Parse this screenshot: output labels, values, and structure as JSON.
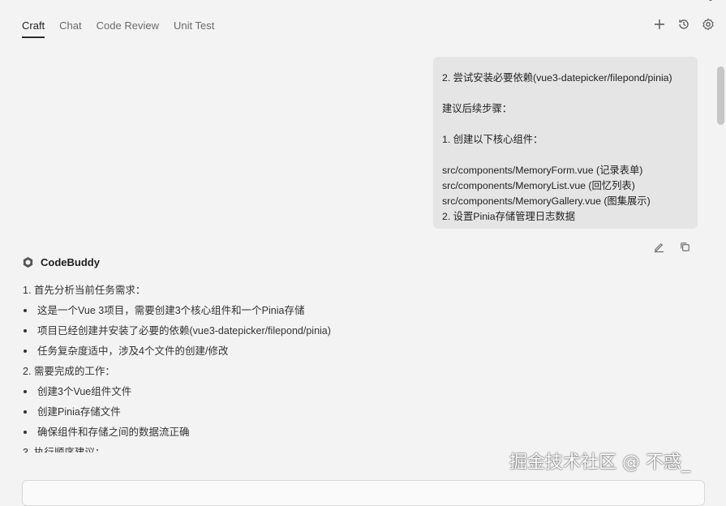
{
  "tabs": [
    {
      "label": "Craft",
      "active": true
    },
    {
      "label": "Chat",
      "active": false
    },
    {
      "label": "Code Review",
      "active": false
    },
    {
      "label": "Unit Test",
      "active": false
    }
  ],
  "header_icons": [
    "plus-icon",
    "history-icon",
    "settings-icon"
  ],
  "user_message": {
    "lines": [
      "2. 尝试安装必要依赖(vue3-datepicker/filepond/pinia)",
      "",
      "建议后续步骤：",
      "",
      "1. 创建以下核心组件：",
      "",
      "src/components/MemoryForm.vue (记录表单)",
      "src/components/MemoryList.vue (回忆列表)",
      "src/components/MemoryGallery.vue (图集展示)",
      "2. 设置Pinia存储管理日志数据"
    ]
  },
  "message_actions": [
    "edit-icon",
    "copy-icon"
  ],
  "assistant": {
    "name": "CodeBuddy",
    "lines": [
      {
        "text": "1. 首先分析当前任务需求：",
        "bullet": false
      },
      {
        "text": "这是一个Vue 3项目，需要创建3个核心组件和一个Pinia存储",
        "bullet": true
      },
      {
        "text": "项目已经创建并安装了必要的依赖(vue3-datepicker/filepond/pinia)",
        "bullet": true
      },
      {
        "text": "任务复杂度适中，涉及4个文件的创建/修改",
        "bullet": true
      },
      {
        "text": "2. 需要完成的工作：",
        "bullet": false
      },
      {
        "text": "创建3个Vue组件文件",
        "bullet": true
      },
      {
        "text": "创建Pinia存储文件",
        "bullet": true
      },
      {
        "text": "确保组件和存储之间的数据流正确",
        "bullet": true
      },
      {
        "text": "3. 执行顺序建议：",
        "bullet": false
      }
    ]
  },
  "watermark": "掘金技术社区 @ 不惑_",
  "colors": {
    "background": "#f3f3f3",
    "bubble": "#e5e5e5",
    "accent": "#2b2b2b"
  }
}
